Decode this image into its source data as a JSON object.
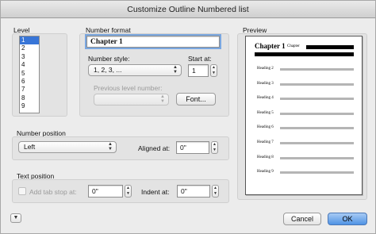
{
  "window": {
    "title": "Customize Outline Numbered list"
  },
  "level": {
    "label": "Level",
    "items": [
      "1",
      "2",
      "3",
      "4",
      "5",
      "6",
      "7",
      "8",
      "9"
    ],
    "selected": "1"
  },
  "number_format": {
    "label": "Number format",
    "value": "Chapter 1",
    "style_label": "Number style:",
    "style_value": "1, 2, 3, ...",
    "start_label": "Start at:",
    "start_value": "1",
    "prev_label": "Previous level number:",
    "prev_value": "",
    "font_button": "Font..."
  },
  "number_position": {
    "label": "Number position",
    "alignment_value": "Left",
    "aligned_at_label": "Aligned at:",
    "aligned_at_value": "0\""
  },
  "text_position": {
    "label": "Text position",
    "tab_stop_label": "Add tab stop at:",
    "tab_stop_value": "0\"",
    "indent_label": "Indent at:",
    "indent_value": "0\""
  },
  "preview": {
    "label": "Preview",
    "chapter_text": "Chapter 1",
    "chapter_suffix": "Chapter",
    "headings": [
      "Heading 2",
      "Heading 3",
      "Heading 4",
      "Heading 5",
      "Heading 6",
      "Heading 7",
      "Heading 8",
      "Heading 9"
    ]
  },
  "footer": {
    "cancel_label": "Cancel",
    "ok_label": "OK"
  },
  "icons": {
    "disclosure": "chevron-down-icon",
    "popup_arrows": "up-down-arrows-icon"
  },
  "colors": {
    "selection": "#3875d7",
    "default_button": "#4f93e4"
  }
}
